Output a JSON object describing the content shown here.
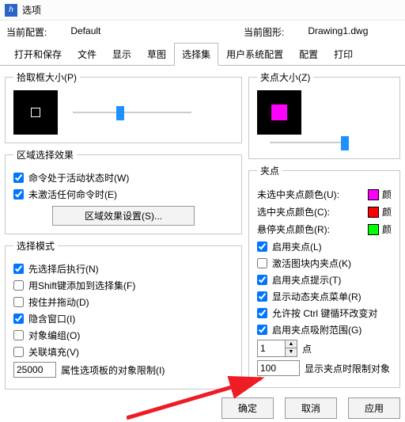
{
  "window_title": "选项",
  "profile": {
    "current_label": "当前配置:",
    "current_value": "Default",
    "drawing_label": "当前图形:",
    "drawing_value": "Drawing1.dwg"
  },
  "tabs": {
    "open_save": "打开和保存",
    "files": "文件",
    "display": "显示",
    "drafting": "草图",
    "selection": "选择集",
    "user": "用户系统配置",
    "profiles": "配置",
    "print": "打印"
  },
  "pickbox": {
    "group_title": "拾取框大小(P)"
  },
  "preview_effect": {
    "group_title": "区域选择效果",
    "active_cmd": "命令处于活动状态时(W)",
    "no_active_cmd": "未激活任何命令时(E)",
    "settings_btn": "区域效果设置(S)..."
  },
  "sel_mode": {
    "group_title": "选择模式",
    "noun_verb": "先选择后执行(N)",
    "use_shift": "用Shift键添加到选择集(F)",
    "press_drag": "按住并拖动(D)",
    "implied_window": "隐含窗口(I)",
    "object_group": "对象编组(O)",
    "assoc_hatch": "关联填充(V)",
    "limit_value": "25000",
    "limit_label": "属性选项板的对象限制(I)"
  },
  "grip_size": {
    "group_title": "夹点大小(Z)"
  },
  "grips": {
    "group_title": "夹点",
    "unsel_color_label": "未选中夹点颜色(U):",
    "sel_color_label": "选中夹点颜色(C):",
    "hover_color_label": "悬停夹点颜色(R):",
    "unsel_color": "#ff00ff",
    "sel_color": "#ff0000",
    "hover_color": "#00ff00",
    "color_suffix": "颜",
    "enable_grips": "启用夹点(L)",
    "enable_block_grips": "激活图块内夹点(K)",
    "enable_tips": "启用夹点提示(T)",
    "dynamic_menu": "显示动态夹点菜单(R)",
    "ctrl_cycle": "允许按 Ctrl 键循环改变对",
    "snap_range": "启用夹点吸附范围(G)",
    "pt_value": "1",
    "pt_label": "点",
    "limit_value": "100",
    "limit_label": "显示夹点时限制对象"
  },
  "footer": {
    "ok": "确定",
    "cancel": "取消",
    "apply": "应用"
  }
}
